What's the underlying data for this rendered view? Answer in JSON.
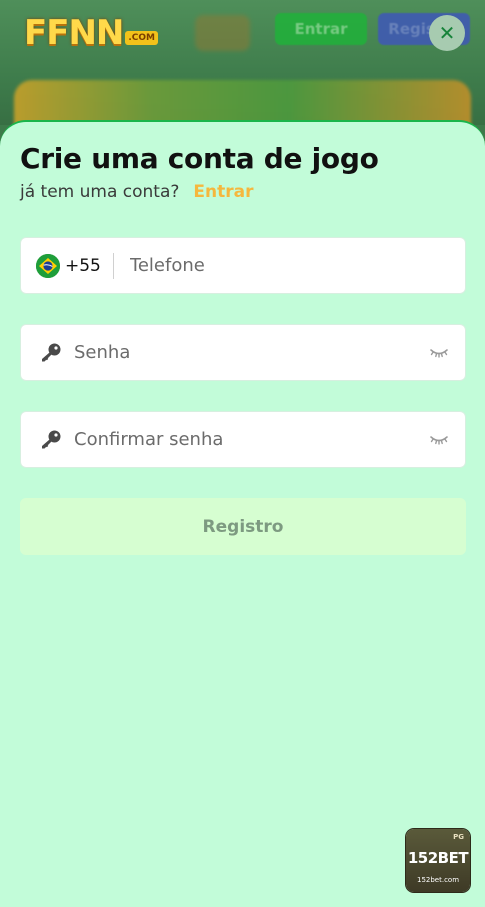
{
  "header": {
    "logo_text": "FFNN",
    "logo_badge": ".COM",
    "enter_button": "Entrar",
    "register_button": "Registro",
    "close_glyph": "✕"
  },
  "signup": {
    "title": "Crie uma conta de jogo",
    "have_account": "já tem uma conta?",
    "login_link": "Entrar",
    "phone": {
      "country_flag": "brazil-flag-icon",
      "dial_code": "+55",
      "placeholder": "Telefone",
      "value": ""
    },
    "password": {
      "placeholder": "Senha",
      "value": "",
      "icon": "key-icon",
      "toggle_icon": "eye-closed-icon"
    },
    "confirm_password": {
      "placeholder": "Confirmar senha",
      "value": "",
      "icon": "key-icon",
      "toggle_icon": "eye-closed-icon"
    },
    "submit_label": "Registro"
  },
  "ad": {
    "tag": "PG",
    "brand": "152BET",
    "site": "152bet.com"
  },
  "colors": {
    "sheet_bg": "#c2fcd9",
    "accent_link": "#f5b73d",
    "submit_bg": "#d6fed1",
    "border_green": "#19b54b"
  }
}
